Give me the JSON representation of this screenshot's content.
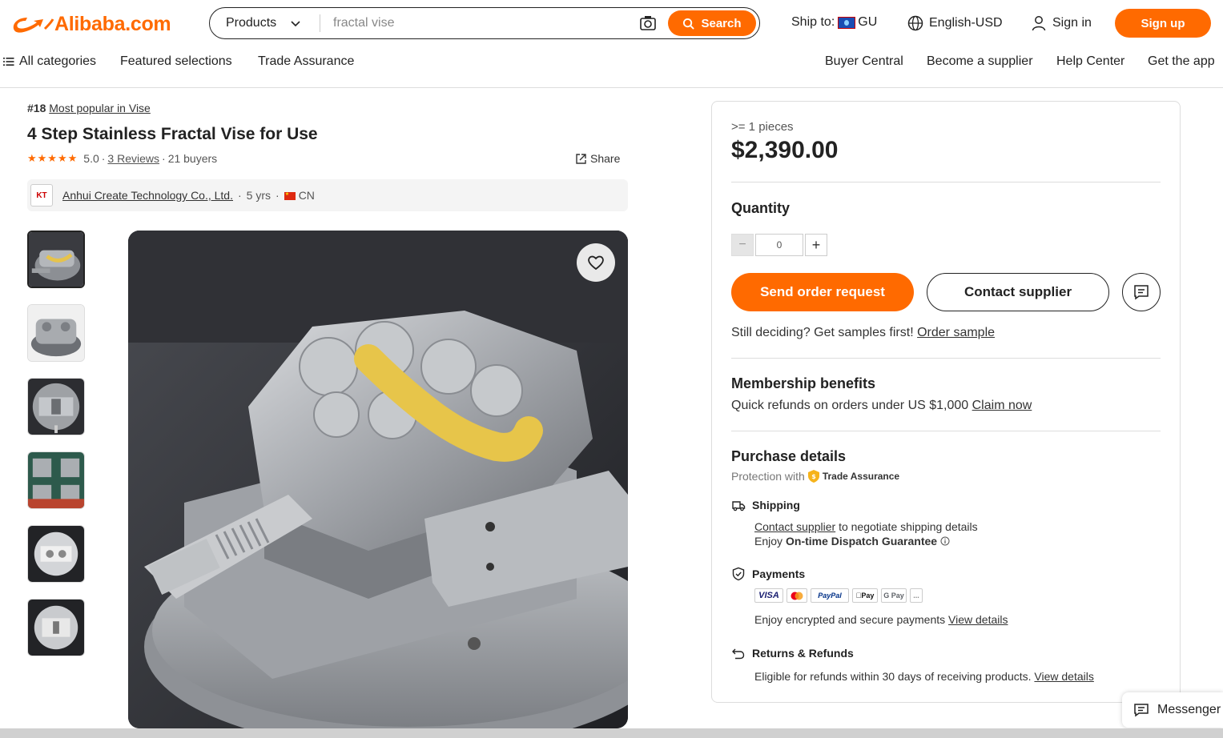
{
  "header": {
    "logo_text": "Alibaba.com",
    "search": {
      "category": "Products",
      "query": "fractal vise",
      "button": "Search"
    },
    "ship_to_label": "Ship to:",
    "ship_to_country": "GU",
    "language": "English-USD",
    "sign_in": "Sign in",
    "sign_up": "Sign up"
  },
  "nav": {
    "left": [
      "All categories",
      "Featured selections",
      "Trade Assurance"
    ],
    "right": [
      "Buyer Central",
      "Become a supplier",
      "Help Center",
      "Get the app"
    ]
  },
  "product": {
    "rank": "#18",
    "rank_link": "Most popular in Vise",
    "title": "4 Step Stainless Fractal Vise for Use",
    "rating": "5.0",
    "stars": 5,
    "reviews": "3 Reviews",
    "buyers": "21 buyers",
    "share": "Share",
    "supplier": {
      "name": "Anhui Create Technology Co., Ltd.",
      "years": "5 yrs",
      "country": "CN",
      "logo_text": "KT"
    },
    "thumbnail_count": 6
  },
  "panel": {
    "min_order": ">= 1 pieces",
    "price": "$2,390.00",
    "quantity_label": "Quantity",
    "quantity_value": "0",
    "send_order": "Send order request",
    "contact_supplier": "Contact supplier",
    "samples_text": "Still deciding? Get samples first!",
    "samples_link": "Order sample",
    "membership_title": "Membership benefits",
    "membership_text": "Quick refunds on orders under US $1,000",
    "membership_link": "Claim now",
    "purchase_title": "Purchase details",
    "protection_text": "Protection with",
    "trade_assurance": "Trade Assurance",
    "shipping": {
      "title": "Shipping",
      "link": "Contact supplier",
      "text": "to negotiate shipping details",
      "enjoy": "Enjoy",
      "guarantee": "On-time Dispatch Guarantee"
    },
    "payments": {
      "title": "Payments",
      "methods": [
        "VISA",
        "MC",
        "PayPal",
        "Apple Pay",
        "G Pay",
        "..."
      ],
      "text": "Enjoy encrypted and secure payments",
      "link": "View details"
    },
    "returns": {
      "title": "Returns & Refunds",
      "text": "Eligible for refunds within 30 days of receiving products.",
      "link": "View details"
    }
  },
  "messenger": "Messenger",
  "colors": {
    "brand_orange": "#ff6a00",
    "text_dark": "#222222"
  }
}
